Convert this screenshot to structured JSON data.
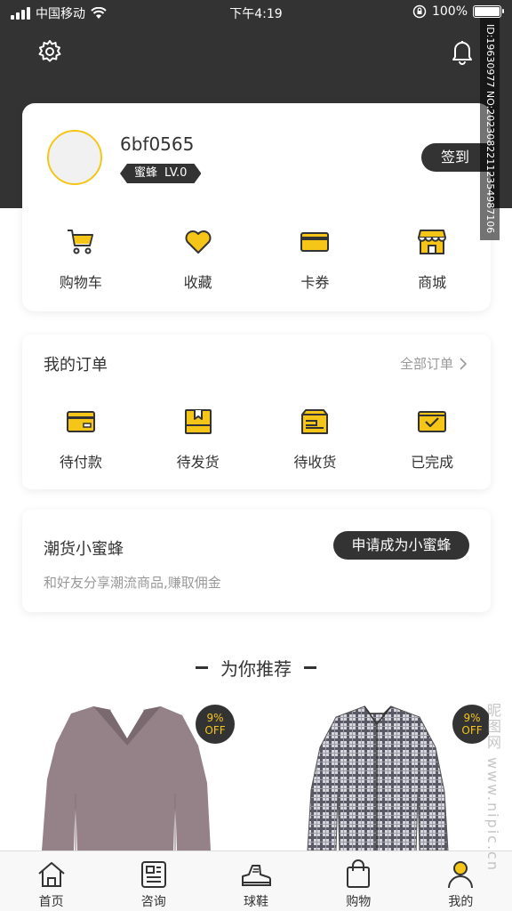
{
  "status_bar": {
    "carrier": "中国移动",
    "time": "下午4:19",
    "battery": "100%"
  },
  "profile": {
    "username": "6bf0565",
    "badge_name": "蜜蜂",
    "badge_level": "LV.0",
    "signin_label": "签到"
  },
  "quick_actions": [
    {
      "label": "购物车",
      "icon": "cart-icon"
    },
    {
      "label": "收藏",
      "icon": "heart-icon"
    },
    {
      "label": "卡券",
      "icon": "coupon-icon"
    },
    {
      "label": "商城",
      "icon": "store-icon"
    }
  ],
  "orders": {
    "title": "我的订单",
    "all_label": "全部订单",
    "items": [
      {
        "label": "待付款",
        "icon": "payment-card-icon"
      },
      {
        "label": "待发货",
        "icon": "package-icon"
      },
      {
        "label": "待收货",
        "icon": "truck-box-icon"
      },
      {
        "label": "已完成",
        "icon": "completed-check-icon"
      }
    ]
  },
  "bee": {
    "title": "潮货小蜜蜂",
    "desc": "和好友分享潮流商品,赚取佣金",
    "button_label": "申请成为小蜜蜂"
  },
  "recommend": {
    "title": "为你推荐",
    "products": [
      {
        "discount": "9%",
        "off": "OFF",
        "image": "gray-v-neck-sweater"
      },
      {
        "discount": "9%",
        "off": "OFF",
        "image": "plaid-shirt"
      }
    ]
  },
  "tabbar": [
    {
      "label": "首页",
      "icon": "home-icon"
    },
    {
      "label": "咨询",
      "icon": "news-icon"
    },
    {
      "label": "球鞋",
      "icon": "sneaker-icon"
    },
    {
      "label": "购物",
      "icon": "shopping-bag-icon"
    },
    {
      "label": "我的",
      "icon": "profile-icon"
    }
  ],
  "watermark": {
    "id_text": "ID:19630977 NO:20230822112354987106",
    "site": "昵图网 www.nipic.cn"
  },
  "colors": {
    "accent": "#f5c518",
    "dark": "#333333"
  }
}
